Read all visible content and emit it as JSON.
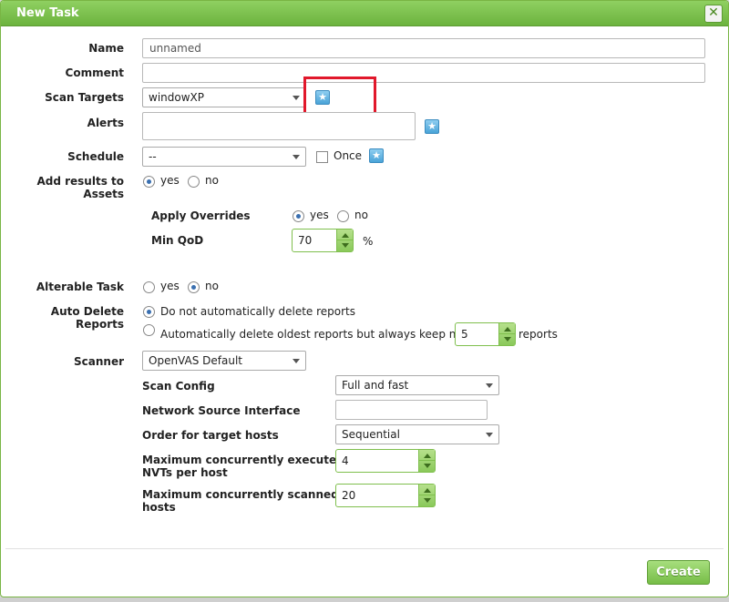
{
  "dialog": {
    "title": "New Task",
    "close_label": "✕"
  },
  "form": {
    "name": {
      "label": "Name",
      "value": "unnamed"
    },
    "comment": {
      "label": "Comment",
      "value": ""
    },
    "scan_targets": {
      "label": "Scan Targets",
      "value": "windowXP"
    },
    "alerts": {
      "label": "Alerts"
    },
    "schedule": {
      "label": "Schedule",
      "value": "--",
      "once_label": "Once"
    },
    "add_results": {
      "label_1": "Add results to",
      "label_2": "Assets",
      "yes": "yes",
      "no": "no",
      "selected": "yes"
    },
    "apply_overrides": {
      "label": "Apply Overrides",
      "yes": "yes",
      "no": "no",
      "selected": "yes"
    },
    "min_qod": {
      "label": "Min QoD",
      "value": "70",
      "unit": "%"
    },
    "alterable_task": {
      "label": "Alterable Task",
      "yes": "yes",
      "no": "no",
      "selected": "no"
    },
    "auto_delete": {
      "label_1": "Auto Delete",
      "label_2": "Reports",
      "option_1": "Do not automatically delete reports",
      "option_2": "Automatically delete oldest reports but always keep newest",
      "keep_value": "5",
      "keep_unit": "reports"
    },
    "scanner": {
      "label": "Scanner",
      "value": "OpenVAS Default"
    },
    "scan_config": {
      "label": "Scan Config",
      "value": "Full and fast"
    },
    "network_source": {
      "label": "Network Source Interface",
      "value": ""
    },
    "order_hosts": {
      "label": "Order for target hosts",
      "value": "Sequential"
    },
    "max_nvts": {
      "label_1": "Maximum concurrently executed",
      "label_2": "NVTs per host",
      "value": "4"
    },
    "max_hosts": {
      "label_1": "Maximum concurrently scanned",
      "label_2": "hosts",
      "value": "20"
    }
  },
  "actions": {
    "create": "Create"
  },
  "icons": {
    "new": "star-icon"
  },
  "colors": {
    "accent": "#6cb33e",
    "highlight": "#e1182b",
    "info_button": "#4aa3d8"
  }
}
